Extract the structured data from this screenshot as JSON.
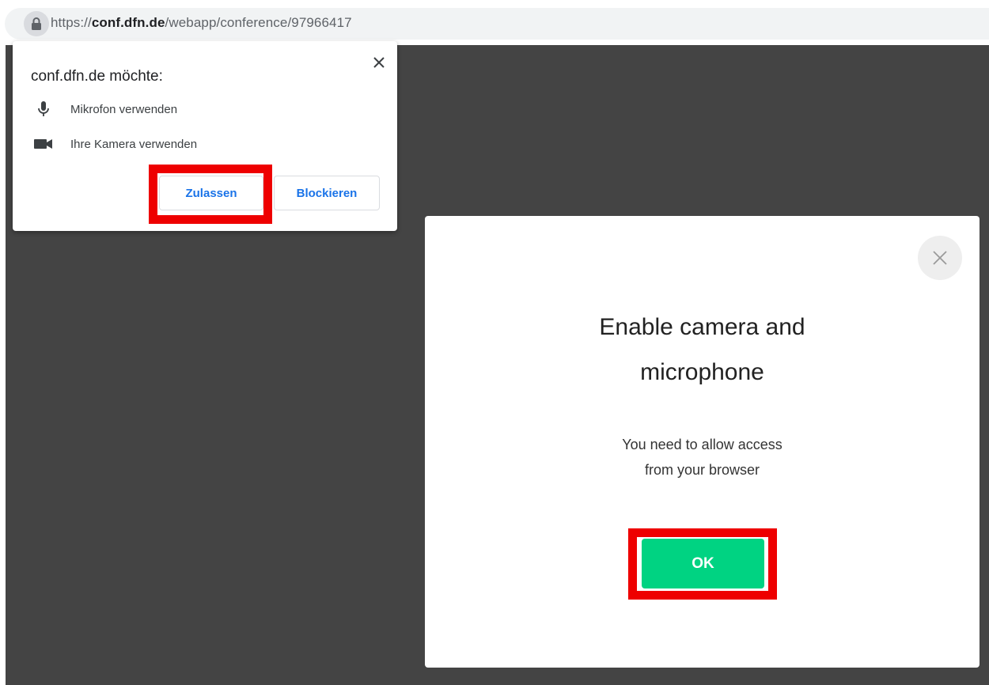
{
  "browser": {
    "url_protocol": "https://",
    "url_host": "conf.dfn.de",
    "url_path": "/webapp/conference/97966417",
    "lock_icon": "lock-icon"
  },
  "permission_prompt": {
    "title": "conf.dfn.de möchte:",
    "items": [
      {
        "icon": "microphone-icon",
        "label": "Mikrofon verwenden"
      },
      {
        "icon": "camera-icon",
        "label": "Ihre Kamera verwenden"
      }
    ],
    "allow_label": "Zulassen",
    "block_label": "Blockieren"
  },
  "modal": {
    "title_line1": "Enable camera and",
    "title_line2": "microphone",
    "text_line1": "You need to allow access",
    "text_line2": "from your browser",
    "ok_label": "OK"
  },
  "colors": {
    "page_background": "#444444",
    "highlight": "#ee0000",
    "ok_button": "#00d382",
    "link_blue": "#1a73e8"
  }
}
